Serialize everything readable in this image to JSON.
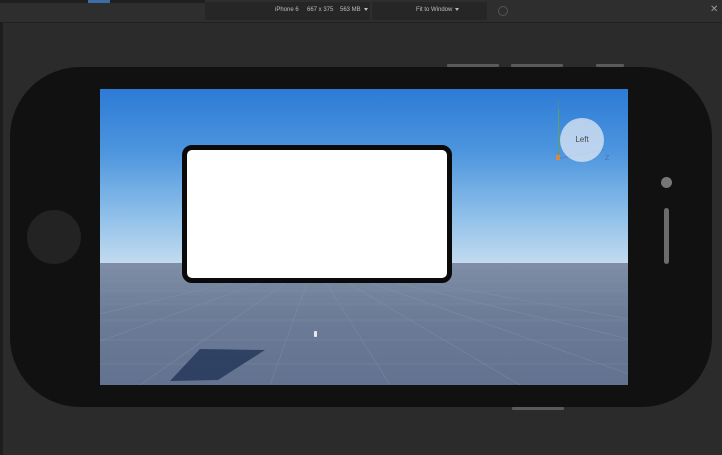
{
  "toolbar": {
    "device_name": "iPhone 6",
    "resolution": "667 x 375",
    "memory": "563 MB",
    "fit_option": "Fit to Window"
  },
  "view_cube": {
    "face_label": "Left",
    "axis_y": "Y",
    "axis_z": "Z"
  },
  "colors": {
    "sky_top": "#2c7bd6",
    "sky_horizon": "#c9def0",
    "ground": "#6d7d98",
    "device_body": "#111111",
    "gui_frame_fill": "#ffffff",
    "gui_frame_border": "#0a0a0a"
  },
  "icons": {
    "device_dropdown": "chevron-down-icon",
    "fit_dropdown": "chevron-down-icon",
    "rotate": "rotate-icon",
    "close": "close-icon"
  }
}
